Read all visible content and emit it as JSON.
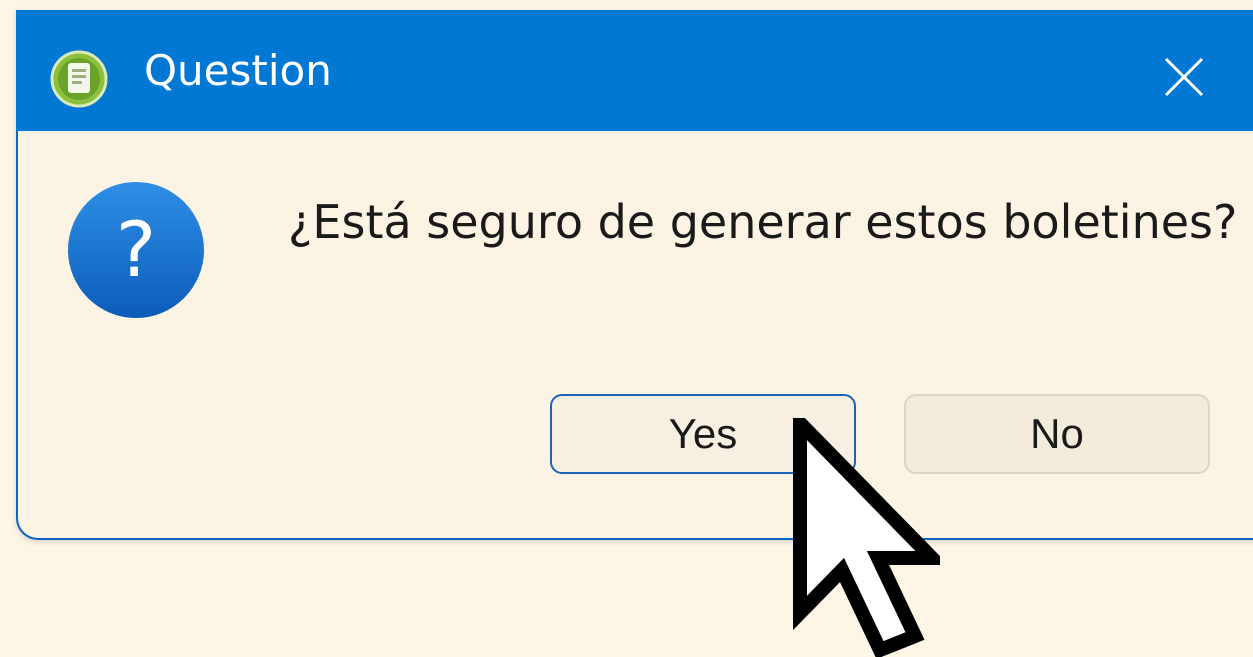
{
  "dialog": {
    "title": "Question",
    "app_icon": "document-app-icon",
    "close_icon": "close-icon",
    "message_icon": "question-icon",
    "question_glyph": "?",
    "message": "¿Está seguro de generar estos boletines?",
    "buttons": {
      "yes_label": "Yes",
      "no_label": "No"
    }
  },
  "cursor": "arrow-cursor-icon",
  "colors": {
    "titlebar": "#0078d4",
    "background": "#fbf3e4",
    "focus_border": "#1c63b8"
  }
}
